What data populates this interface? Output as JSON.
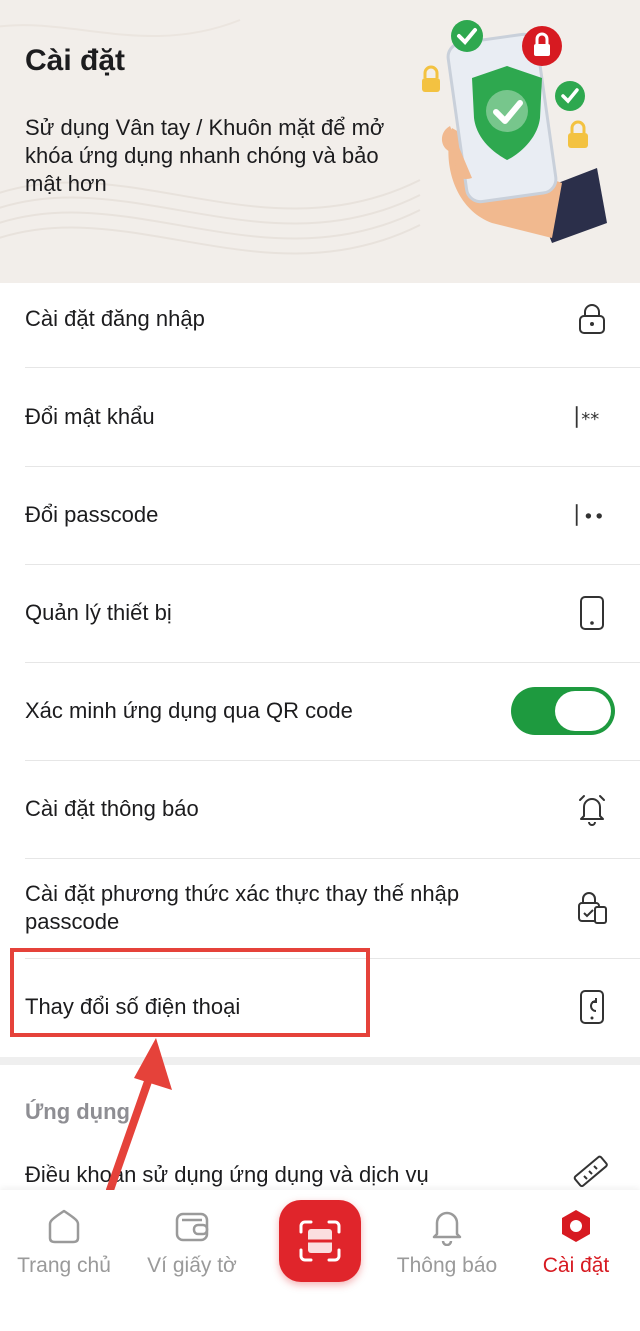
{
  "header": {
    "title": "Cài đặt",
    "subtitle": "Sử dụng Vân tay / Khuôn mặt để mở  khóa ứng dụng nhanh chóng và bảo mật hơn"
  },
  "settings": {
    "items": [
      {
        "label": "Cài đặt đăng nhập",
        "icon": "lock-icon"
      },
      {
        "label": "Đổi mật khẩu",
        "icon": "password-icon"
      },
      {
        "label": "Đổi passcode",
        "icon": "passcode-icon"
      },
      {
        "label": "Quản lý thiết bị",
        "icon": "phone-device-icon"
      },
      {
        "label": "Xác minh ứng dụng qua QR code",
        "toggle": true,
        "toggle_on": true
      },
      {
        "label": "Cài đặt thông báo",
        "icon": "bell-icon"
      },
      {
        "label": "Cài đặt phương thức xác thực thay thế nhập passcode",
        "icon": "auth-method-icon"
      },
      {
        "label": "Thay đổi số điện thoại",
        "icon": "phone-change-icon"
      }
    ]
  },
  "apps_section": {
    "title": "Ứng dụng",
    "items": [
      {
        "label": "Điều khoản sử dụng ứng dụng và dịch vụ",
        "icon": "ruler-icon"
      }
    ]
  },
  "bottom_nav": {
    "items": [
      {
        "label": "Trang chủ",
        "icon": "home-icon",
        "active": false
      },
      {
        "label": "Ví giấy tờ",
        "icon": "wallet-icon",
        "active": false
      },
      {
        "label": "",
        "icon": "scan-icon",
        "active": false
      },
      {
        "label": "Thông báo",
        "icon": "bell-icon",
        "active": false
      },
      {
        "label": "Cài đặt",
        "icon": "settings-hex-icon",
        "active": true
      }
    ]
  },
  "colors": {
    "accent_red": "#d71a21",
    "toggle_green": "#1e9a3f",
    "annotation_red": "#e5423a",
    "header_bg": "#f2eeea"
  }
}
